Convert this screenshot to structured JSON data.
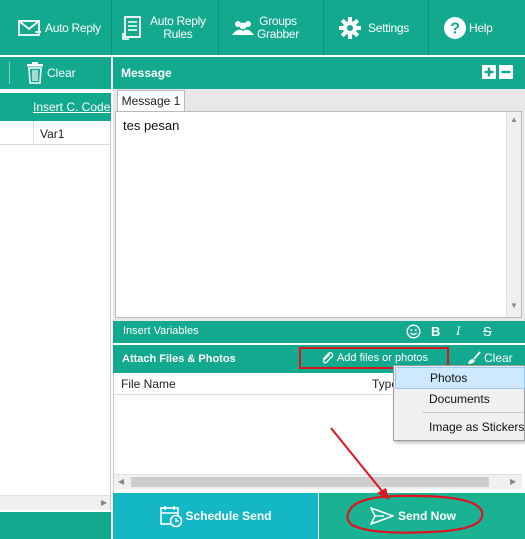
{
  "toolbar": {
    "auto_reply": "Auto Reply",
    "auto_reply_rules_line1": "Auto Reply",
    "auto_reply_rules_line2": "Rules",
    "groups_grabber_line1": "Groups",
    "groups_grabber_line2": "Grabber",
    "settings": "Settings",
    "help": "Help"
  },
  "left": {
    "clear_label": "Clear",
    "insert_code_link": "Insert C. Code",
    "column_var1": "Var1"
  },
  "message": {
    "header": "Message",
    "tab_label": "Message 1",
    "text": "tes pesan",
    "insert_variables": "Insert Variables",
    "bold": "B",
    "italic": "I",
    "strike": "S"
  },
  "attach": {
    "header": "Attach Files & Photos",
    "add_files": "Add files or photos",
    "clear": "Clear",
    "col_file_name": "File Name",
    "col_type": "Type"
  },
  "context_menu": {
    "items": [
      "Photos",
      "Documents",
      "Image as Stickers"
    ],
    "highlighted": "Photos"
  },
  "bottom": {
    "schedule_send": "Schedule Send",
    "send_now": "Send Now"
  },
  "colors": {
    "primary": "#12a98f",
    "schedule": "#14b8c4",
    "send": "#19b394",
    "annotation": "#e0121b",
    "highlight": "#cde8ff"
  },
  "icons": {
    "auto_reply": "envelope-reply-icon",
    "rules": "document-list-icon",
    "groups": "people-icon",
    "settings": "gear-icon",
    "help": "question-icon",
    "trash": "trash-icon",
    "add": "plus-icon",
    "remove": "minus-icon",
    "emoji": "smiley-icon",
    "paperclip": "paperclip-icon",
    "brush": "brush-icon",
    "calendar": "calendar-clock-icon",
    "send": "paper-plane-icon"
  }
}
